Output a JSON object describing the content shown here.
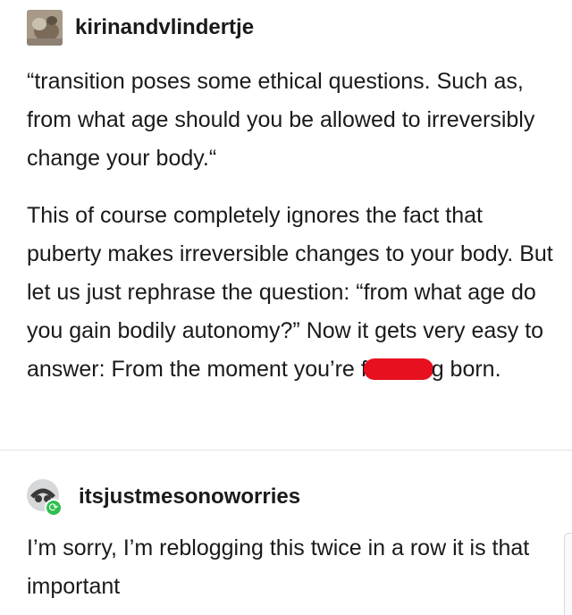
{
  "post1": {
    "username": "kirinandvlindertje",
    "quote": "“transition poses some ethical questions. Such as, from what age should you be allowed to irreversibly change your body.“",
    "paragraph_before_censor": "This of course completely ignores the fact that puberty makes irreversible changes to your body. But let us just rephrase the question: “from what age do you gain bodily autonomy?” Now it gets very easy to answer: From the moment you’re f",
    "paragraph_after_censor": "g born."
  },
  "post2": {
    "username": "itsjustmesonoworries",
    "text": "I’m sorry, I’m reblogging this twice in a row it is that important"
  },
  "colors": {
    "censor": "#e6101f",
    "reblog_badge": "#2fbf4f"
  },
  "icons": {
    "avatar1": "user-avatar-icon",
    "avatar2": "user-avatar-icon",
    "reblog": "reblog-icon"
  }
}
